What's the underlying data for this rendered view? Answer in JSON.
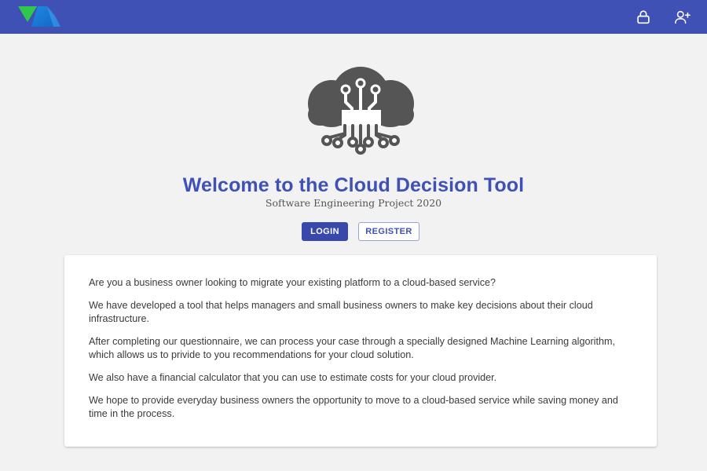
{
  "colors": {
    "topbar": "#3f51b5",
    "accent": "#3f51b5",
    "background": "#f2f2f3"
  },
  "header": {
    "logo_icon": "vuetify-logo-icon",
    "icons": [
      "lock-icon",
      "add-user-icon"
    ]
  },
  "hero": {
    "icon": "cloud-circuit-icon",
    "title": "Welcome to the Cloud Decision Tool",
    "subtitle": "Software Engineering Project 2020",
    "login_label": "LOGIN",
    "register_label": "REGISTER"
  },
  "intro": {
    "paragraphs": [
      "Are you a business owner looking to migrate your existing platform to a cloud-based service?",
      "We have developed a tool that helps managers and small business owners to make key decisions about their cloud infrastructure.",
      "After completing our questionnaire, we can process your case through a specially designed Machine Learning algorithm, which allows us to privide to you recommendations for your cloud solution.",
      "We also have a financial calculator that you can use to estimate costs for your cloud provider.",
      "We hope to provide everyday business owners the opportunity to move to a cloud-based service while saving money and time in the process."
    ]
  }
}
